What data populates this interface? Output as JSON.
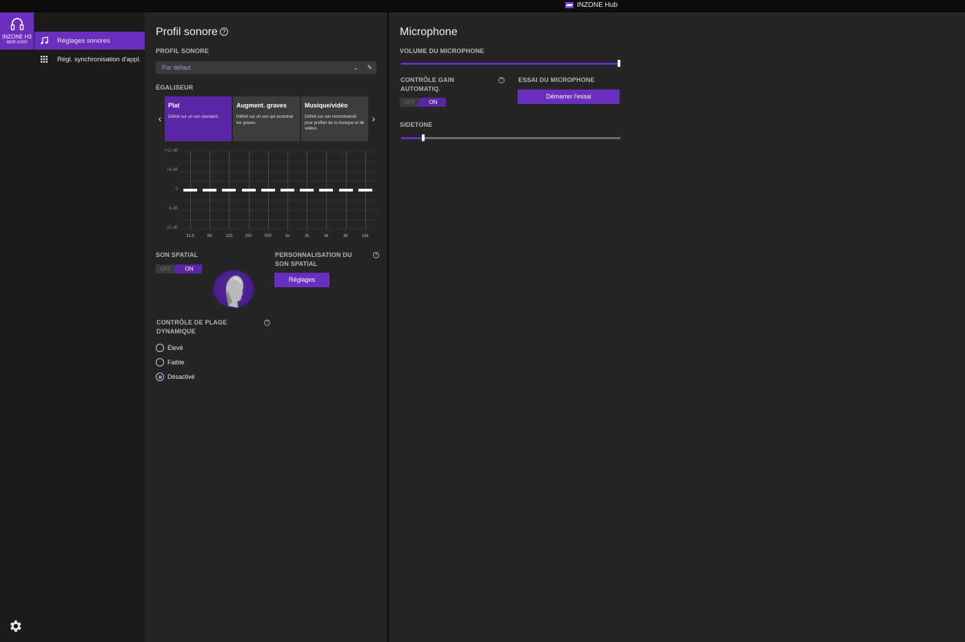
{
  "titlebar": {
    "app_name": "INZONE Hub"
  },
  "device": {
    "name": "INZONE H3",
    "model": "MDR-G300"
  },
  "nav": {
    "items": [
      {
        "label": "Réglages sonores",
        "icon": "music-note-icon",
        "active": true
      },
      {
        "label": "Régl. synchronisation d'appl.",
        "icon": "grid-icon",
        "active": false
      }
    ]
  },
  "sound_profile": {
    "title": "Profil sonore",
    "profile_label": "PROFIL SONORE",
    "profile_value": "Par défaut",
    "eq_label": "ÉGALISEUR",
    "presets": [
      {
        "title": "Plat",
        "desc": "Définit sur un son standard.",
        "active": true
      },
      {
        "title": "Augment. graves",
        "desc": "Définit sur un son qui accentue les graves.",
        "active": false
      },
      {
        "title": "Musique/vidéo",
        "desc": "Définit sur son recommandé pour profiter de la musique et de vidéos.",
        "active": false
      }
    ],
    "eq": {
      "y_labels": [
        "+12 dB",
        "+6 dB",
        "0",
        "-6 dB",
        "-12 dB"
      ],
      "bands": [
        "31.5",
        "63",
        "125",
        "250",
        "500",
        "1k",
        "2k",
        "4k",
        "8k",
        "16k"
      ],
      "gains_db": [
        0,
        0,
        0,
        0,
        0,
        0,
        0,
        0,
        0,
        0
      ],
      "range_db": [
        -12,
        12
      ]
    },
    "spatial_label": "SON SPATIAL",
    "spatial_toggle": {
      "off": "OFF",
      "on": "ON",
      "state": "on"
    },
    "personalization_label": "PERSONNALISATION DU SON SPATIAL",
    "settings_button": "Réglages",
    "drc_label": "CONTRÔLE DE PLAGE DYNAMIQUE",
    "drc_options": [
      {
        "label": "Élevé",
        "selected": false
      },
      {
        "label": "Faible",
        "selected": false
      },
      {
        "label": "Désactivé",
        "selected": true
      }
    ]
  },
  "microphone": {
    "title": "Microphone",
    "volume_label": "VOLUME DU MICROPHONE",
    "volume_fraction": 1.0,
    "agc_label": "CONTRÔLE GAIN AUTOMATIQ.",
    "agc_toggle": {
      "off": "OFF",
      "on": "ON",
      "state": "on"
    },
    "test_label": "ESSAI DU MICROPHONE",
    "test_button": "Démarrer l'essai",
    "sidetone_label": "SIDETONE",
    "sidetone_fraction": 0.1
  },
  "colors": {
    "accent": "#6b2fbf",
    "panel": "#252525",
    "sidebar": "#1b1b1b"
  }
}
